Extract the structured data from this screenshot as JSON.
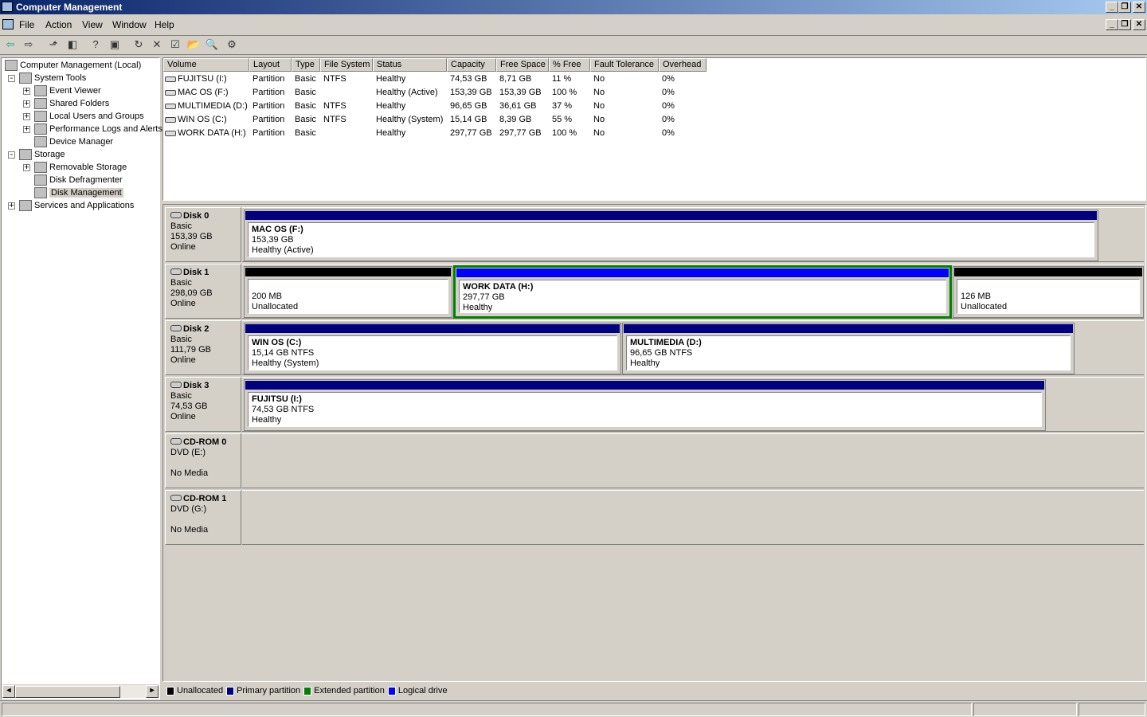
{
  "window": {
    "title": "Computer Management"
  },
  "menu": [
    "File",
    "Action",
    "View",
    "Window",
    "Help"
  ],
  "toolbar": [
    "back-icon",
    "forward-icon",
    "up-folder-icon",
    "show-hide-tree-icon",
    "help-icon",
    "action-pane-icon",
    "refresh-icon",
    "delete-icon",
    "properties-icon",
    "open-icon",
    "search-icon",
    "settings-icon"
  ],
  "tree": {
    "root": "Computer Management (Local)",
    "items": [
      {
        "label": "System Tools",
        "level": 1,
        "exp": "-"
      },
      {
        "label": "Event Viewer",
        "level": 2,
        "exp": "+"
      },
      {
        "label": "Shared Folders",
        "level": 2,
        "exp": "+"
      },
      {
        "label": "Local Users and Groups",
        "level": 2,
        "exp": "+"
      },
      {
        "label": "Performance Logs and Alerts",
        "level": 2,
        "exp": "+"
      },
      {
        "label": "Device Manager",
        "level": 2,
        "exp": ""
      },
      {
        "label": "Storage",
        "level": 1,
        "exp": "-"
      },
      {
        "label": "Removable Storage",
        "level": 2,
        "exp": "+"
      },
      {
        "label": "Disk Defragmenter",
        "level": 2,
        "exp": ""
      },
      {
        "label": "Disk Management",
        "level": 2,
        "exp": "",
        "selected": true
      },
      {
        "label": "Services and Applications",
        "level": 1,
        "exp": "+"
      }
    ]
  },
  "volumes": {
    "columns": [
      "Volume",
      "Layout",
      "Type",
      "File System",
      "Status",
      "Capacity",
      "Free Space",
      "% Free",
      "Fault Tolerance",
      "Overhead"
    ],
    "rows": [
      [
        "FUJITSU (I:)",
        "Partition",
        "Basic",
        "NTFS",
        "Healthy",
        "74,53 GB",
        "8,71 GB",
        "11 %",
        "No",
        "0%"
      ],
      [
        "MAC OS (F:)",
        "Partition",
        "Basic",
        "",
        "Healthy (Active)",
        "153,39 GB",
        "153,39 GB",
        "100 %",
        "No",
        "0%"
      ],
      [
        "MULTIMEDIA (D:)",
        "Partition",
        "Basic",
        "NTFS",
        "Healthy",
        "96,65 GB",
        "36,61 GB",
        "37 %",
        "No",
        "0%"
      ],
      [
        "WIN OS (C:)",
        "Partition",
        "Basic",
        "NTFS",
        "Healthy (System)",
        "15,14 GB",
        "8,39 GB",
        "55 %",
        "No",
        "0%"
      ],
      [
        "WORK DATA (H:)",
        "Partition",
        "Basic",
        "",
        "Healthy",
        "297,77 GB",
        "297,77 GB",
        "100 %",
        "No",
        "0%"
      ]
    ]
  },
  "disks": [
    {
      "name": "Disk 0",
      "type": "Basic",
      "size": "153,39 GB",
      "state": "Online",
      "parts": [
        {
          "kind": "primary",
          "name": "MAC OS  (F:)",
          "size": "153,39 GB",
          "status": "Healthy (Active)"
        }
      ]
    },
    {
      "name": "Disk 1",
      "type": "Basic",
      "size": "298,09 GB",
      "state": "Online",
      "parts": [
        {
          "kind": "unallocated",
          "name": "",
          "size": "200 MB",
          "status": "Unallocated"
        },
        {
          "kind": "logical",
          "name": "WORK DATA  (H:)",
          "size": "297,77 GB",
          "status": "Healthy"
        },
        {
          "kind": "unallocated",
          "name": "",
          "size": "126 MB",
          "status": "Unallocated"
        }
      ]
    },
    {
      "name": "Disk 2",
      "type": "Basic",
      "size": "111,79 GB",
      "state": "Online",
      "parts": [
        {
          "kind": "primary",
          "name": "WIN OS  (C:)",
          "size": "15,14 GB NTFS",
          "status": "Healthy (System)"
        },
        {
          "kind": "primary",
          "name": "MULTIMEDIA  (D:)",
          "size": "96,65 GB NTFS",
          "status": "Healthy"
        }
      ]
    },
    {
      "name": "Disk 3",
      "type": "Basic",
      "size": "74,53 GB",
      "state": "Online",
      "parts": [
        {
          "kind": "primary",
          "name": "FUJITSU  (I:)",
          "size": "74,53 GB NTFS",
          "status": "Healthy"
        }
      ]
    },
    {
      "name": "CD-ROM 0",
      "type": "DVD (E:)",
      "size": "",
      "state": "No Media",
      "parts": []
    },
    {
      "name": "CD-ROM 1",
      "type": "DVD (G:)",
      "size": "",
      "state": "No Media",
      "parts": []
    }
  ],
  "legend": [
    {
      "label": "Unallocated",
      "color": "#000000"
    },
    {
      "label": "Primary partition",
      "color": "#000080"
    },
    {
      "label": "Extended partition",
      "color": "#008000"
    },
    {
      "label": "Logical drive",
      "color": "#0000ff"
    }
  ]
}
